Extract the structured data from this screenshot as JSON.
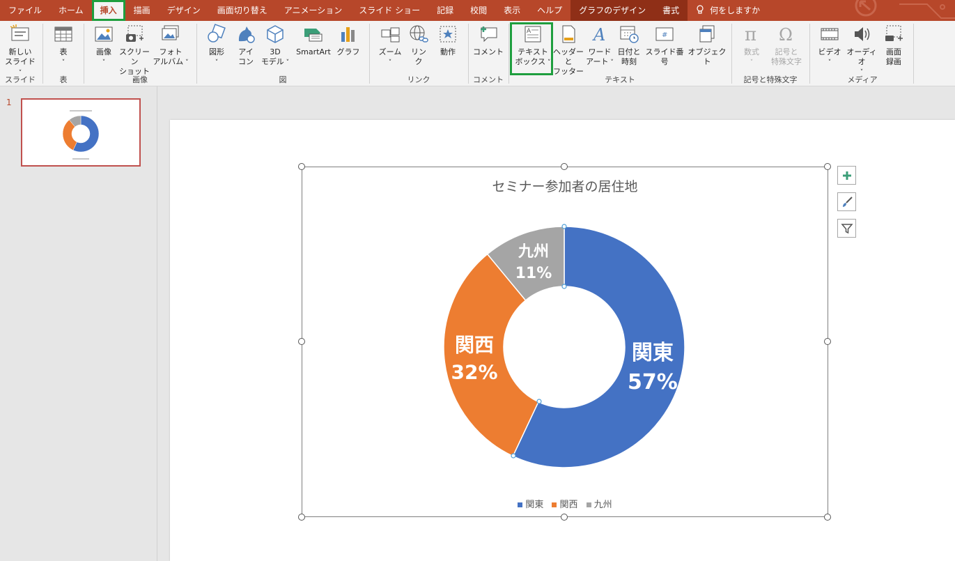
{
  "menu": {
    "tabs": [
      {
        "label": "ファイル"
      },
      {
        "label": "ホーム"
      },
      {
        "label": "挿入"
      },
      {
        "label": "描画"
      },
      {
        "label": "デザイン"
      },
      {
        "label": "画面切り替え"
      },
      {
        "label": "アニメーション"
      },
      {
        "label": "スライド ショー"
      },
      {
        "label": "記録"
      },
      {
        "label": "校閲"
      },
      {
        "label": "表示"
      },
      {
        "label": "ヘルプ"
      },
      {
        "label": "グラフのデザイン"
      },
      {
        "label": "書式"
      }
    ],
    "search": "何をしますか"
  },
  "ribbon": {
    "groups": {
      "slides": "スライド",
      "table": "表",
      "images": "画像",
      "illustrations": "図",
      "links": "リンク",
      "comments": "コメント",
      "text": "テキスト",
      "symbols": "記号と特殊文字",
      "media": "メディア"
    },
    "buttons": {
      "new_slide_1": "新しい",
      "new_slide_2": "スライド",
      "table": "表",
      "image": "画像",
      "screenshot_1": "スクリーン",
      "screenshot_2": "ショット",
      "album_1": "フォト",
      "album_2": "アルバム",
      "shapes": "図形",
      "icons_1": "アイ",
      "icons_2": "コン",
      "model_1": "3D",
      "model_2": "モデル",
      "smartart": "SmartArt",
      "chart": "グラフ",
      "zoom": "ズーム",
      "link_1": "リン",
      "link_2": "ク",
      "action": "動作",
      "comment": "コメント",
      "textbox_1": "テキスト",
      "textbox_2": "ボックス",
      "header_1": "ヘッダーと",
      "header_2": "フッター",
      "wordart_1": "ワード",
      "wordart_2": "アート",
      "datetime_1": "日付と",
      "datetime_2": "時刻",
      "slidenum": "スライド番号",
      "object": "オブジェクト",
      "equation": "数式",
      "symbol_1": "記号と",
      "symbol_2": "特殊文字",
      "video": "ビデオ",
      "audio": "オーディオ",
      "rec_1": "画面",
      "rec_2": "録画"
    }
  },
  "thumbnails": {
    "slide_number": "1"
  },
  "colors": {
    "east": "#4472c4",
    "west": "#ed7d31",
    "kyushu": "#a5a5a5",
    "accent": "#b7472a",
    "highlight": "#1e9e3e"
  },
  "chart_data": {
    "type": "pie",
    "title": "セミナー参加者の居住地",
    "categories": [
      "関東",
      "関西",
      "九州"
    ],
    "values": [
      57,
      32,
      11
    ],
    "data_labels": [
      "57%",
      "32%",
      "11%"
    ],
    "legend": "bottom"
  }
}
